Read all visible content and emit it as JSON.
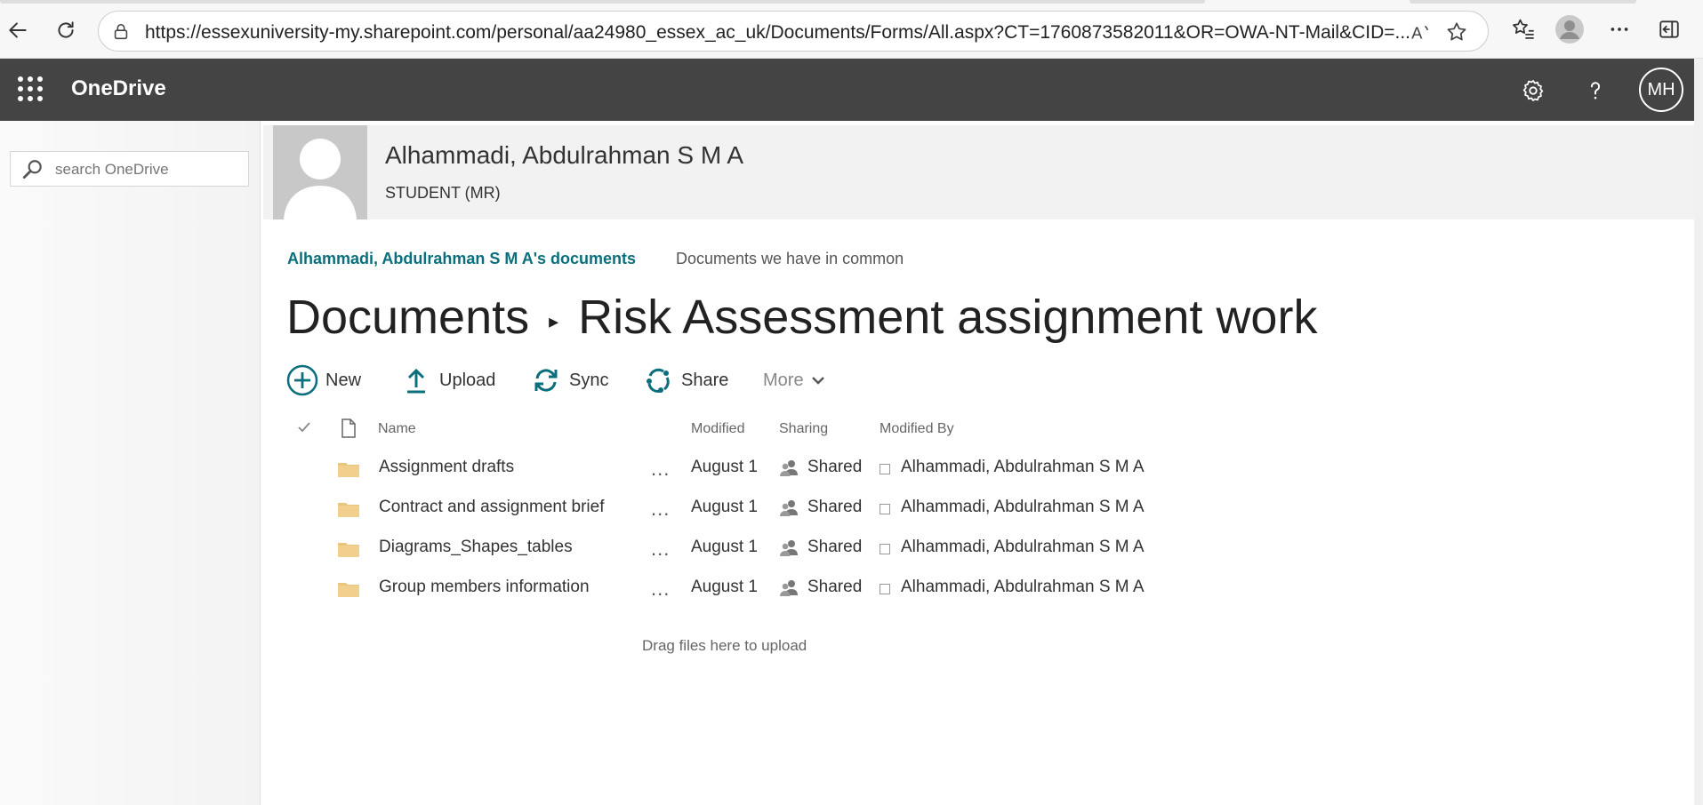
{
  "browser": {
    "url": "https://essexuniversity-my.sharepoint.com/personal/aa24980_essex_ac_uk/Documents/Forms/All.aspx?CT=1760873582011&OR=OWA-NT-Mail&CID=...",
    "icons": [
      "back-icon",
      "refresh-icon",
      "lock-icon",
      "read-aloud-icon",
      "favorite-star-icon",
      "favorites-icon",
      "profile-icon",
      "more-icon",
      "sidebar-icon"
    ]
  },
  "suite": {
    "app_name": "OneDrive",
    "avatar_initials": "MH"
  },
  "left_nav": {
    "search_placeholder": "search OneDrive"
  },
  "profile": {
    "name": "Alhammadi, Abdulrahman S M A",
    "title": "STUDENT (MR)"
  },
  "pivots": {
    "active": "Alhammadi, Abdulrahman S M A's documents",
    "inactive": "Documents we have in common"
  },
  "breadcrumb": {
    "root": "Documents",
    "separator": "›",
    "current": "Risk Assessment assignment work"
  },
  "commands": {
    "new": "New",
    "upload": "Upload",
    "sync": "Sync",
    "share": "Share",
    "more": "More"
  },
  "columns": {
    "name": "Name",
    "modified": "Modified",
    "sharing": "Sharing",
    "modified_by": "Modified By"
  },
  "rows": [
    {
      "name": "Assignment drafts",
      "modified": "August 1",
      "sharing": "Shared",
      "modified_by": "Alhammadi, Abdulrahman S M A",
      "menu": "..."
    },
    {
      "name": "Contract and assignment brief",
      "modified": "August 1",
      "sharing": "Shared",
      "modified_by": "Alhammadi, Abdulrahman S M A",
      "menu": "..."
    },
    {
      "name": "Diagrams_Shapes_tables",
      "modified": "August 1",
      "sharing": "Shared",
      "modified_by": "Alhammadi, Abdulrahman S M A",
      "menu": "..."
    },
    {
      "name": "Group members information",
      "modified": "August 1",
      "sharing": "Shared",
      "modified_by": "Alhammadi, Abdulrahman S M A",
      "menu": "..."
    }
  ],
  "drag_hint": "Drag files here to upload",
  "colors": {
    "suite_bar": "#444444",
    "accent": "#0a6f7c",
    "folder": "#e8c67c"
  }
}
